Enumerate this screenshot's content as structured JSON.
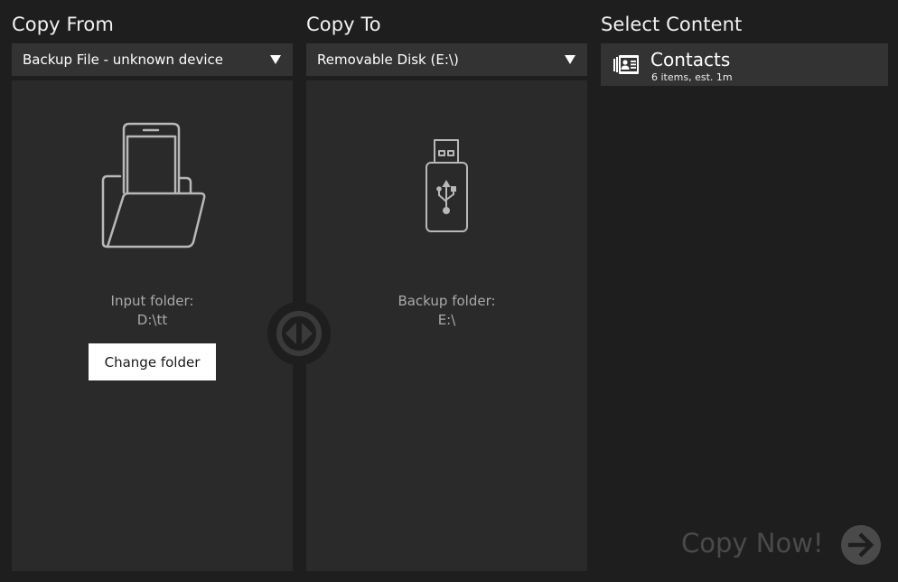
{
  "copy_from": {
    "title": "Copy From",
    "dropdown_value": "Backup File - unknown device",
    "caption_label": "Input folder:",
    "caption_value": "D:\\tt",
    "change_folder_label": "Change folder",
    "icon": "phone-in-folder-icon"
  },
  "copy_to": {
    "title": "Copy To",
    "dropdown_value": "Removable Disk (E:\\)",
    "caption_label": "Backup folder:",
    "caption_value": "E:\\",
    "icon": "usb-drive-icon"
  },
  "select_content": {
    "title": "Select Content",
    "items": [
      {
        "label": "Contacts",
        "detail": "6 items, est. 1m",
        "icon": "contacts-icon"
      }
    ]
  },
  "actions": {
    "copy_now_label": "Copy Now!",
    "swap_icon": "swap-direction-icon",
    "copy_arrow_icon": "arrow-right-icon"
  },
  "colors": {
    "background": "#1e1e1e",
    "panel": "#2a2a2a",
    "dropdown": "#333333",
    "caption": "#aaaaaa",
    "disabled_text": "#4a4a4a"
  }
}
